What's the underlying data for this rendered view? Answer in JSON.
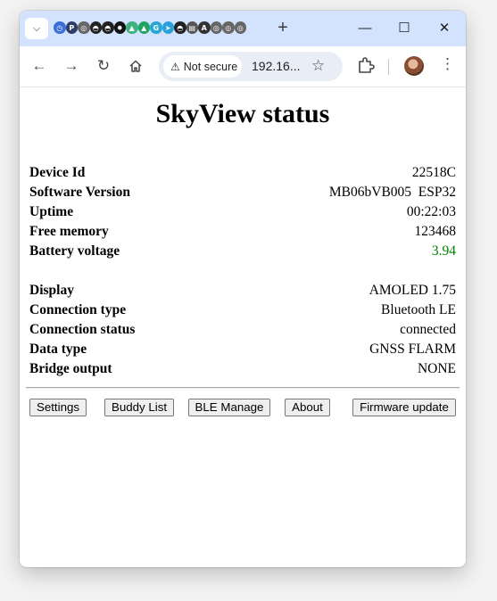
{
  "browser": {
    "favicons": [
      {
        "icon": "clock-icon",
        "color": "#3a6fd8"
      },
      {
        "icon": "p-icon",
        "color": "#2e3d66"
      },
      {
        "icon": "globe-icon",
        "color": "#666666"
      },
      {
        "icon": "github-icon",
        "color": "#222222"
      },
      {
        "icon": "github-icon",
        "color": "#222222"
      },
      {
        "icon": "openai-icon",
        "color": "#111111"
      },
      {
        "icon": "chart-icon",
        "color": "#3fb27f"
      },
      {
        "icon": "drive-icon",
        "color": "#1fa463"
      },
      {
        "icon": "g-icon",
        "color": "#2aa6d5"
      },
      {
        "icon": "telegram-icon",
        "color": "#2aa1da"
      },
      {
        "icon": "github-icon",
        "color": "#222222"
      },
      {
        "icon": "doc-icon",
        "color": "#555555"
      },
      {
        "icon": "a-icon",
        "color": "#333333"
      },
      {
        "icon": "globe-icon",
        "color": "#666666"
      },
      {
        "icon": "globe-icon",
        "color": "#666666"
      },
      {
        "icon": "globe-icon",
        "color": "#666666"
      }
    ],
    "security_label": "Not secure",
    "url": "192.16...",
    "colors": {
      "tabstrip": "#d3e3fd",
      "omnibox": "#e9eef6"
    }
  },
  "page": {
    "title": "SkyView status",
    "status_rows": [
      {
        "label": "Device Id",
        "value": "22518C"
      },
      {
        "label": "Software Version",
        "value": "MB06bVB005  ESP32"
      },
      {
        "label": "Uptime",
        "value": "00:22:03"
      },
      {
        "label": "Free memory",
        "value": "123468"
      },
      {
        "label": "Battery voltage",
        "value": "3.94",
        "value_color": "#008000"
      }
    ],
    "config_rows": [
      {
        "label": "Display",
        "value": "AMOLED 1.75"
      },
      {
        "label": "Connection type",
        "value": "Bluetooth LE"
      },
      {
        "label": "Connection status",
        "value": "connected"
      },
      {
        "label": "Data type",
        "value": "GNSS FLARM"
      },
      {
        "label": "Bridge output",
        "value": "NONE"
      }
    ],
    "buttons": {
      "settings": "Settings",
      "buddy_list": "Buddy List",
      "ble_manage": "BLE Manage",
      "about": "About",
      "firmware_update": "Firmware update"
    }
  }
}
